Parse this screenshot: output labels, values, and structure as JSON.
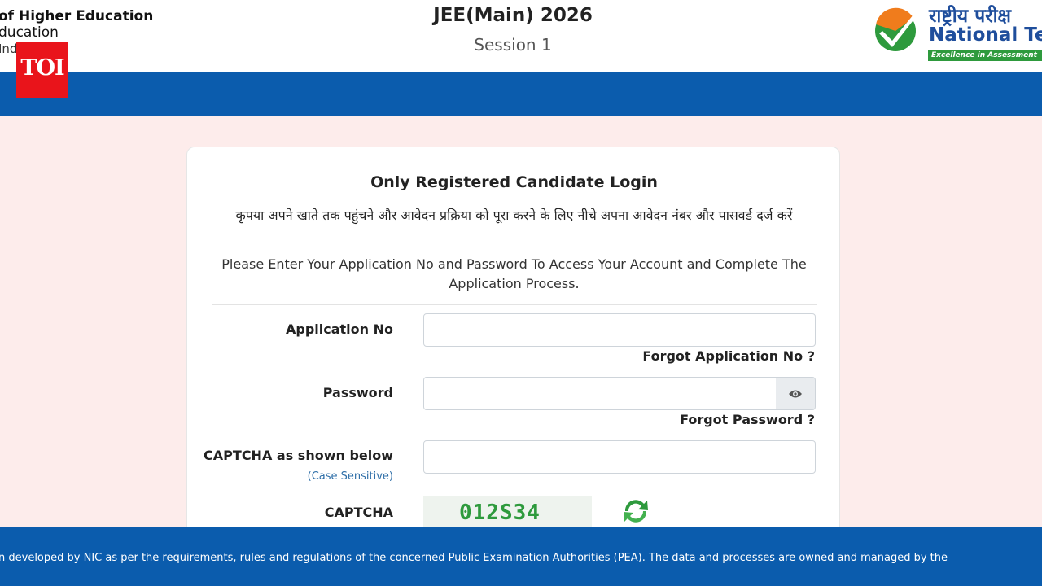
{
  "header": {
    "ministry_line1": "of Higher Education",
    "ministry_line2": "ducation",
    "ministry_line3": "Ind",
    "toi_badge": "TOI",
    "exam_title": "JEE(Main) 2026",
    "session": "Session 1",
    "nta_hindi": "राष्ट्रीय परीक्ष",
    "nta_english": "National Tes",
    "nta_tagline": "Excellence in Assessment"
  },
  "login": {
    "title": "Only Registered Candidate Login",
    "hindi_instruction": "कृपया अपने खाते तक पहुंचने और आवेदन प्रक्रिया को पूरा करने के लिए नीचे अपना आवेदन नंबर और पासवर्ड दर्ज करें",
    "english_instruction": "Please Enter Your Application No and Password To Access Your Account and Complete The Application Process.",
    "application_no_label": "Application No",
    "application_no_value": "",
    "forgot_application": "Forgot Application No ?",
    "password_label": "Password",
    "password_value": "",
    "forgot_password": "Forgot Password ?",
    "captcha_input_label": "CAPTCHA as shown below",
    "case_sensitive": "(Case Sensitive)",
    "captcha_input_value": "",
    "captcha_label": "CAPTCHA",
    "captcha_text": "012S34"
  },
  "footer": {
    "text": "n developed by NIC as per the requirements, rules and regulations of the concerned Public Examination Authorities (PEA). The data and processes are owned and managed by the"
  },
  "colors": {
    "primary_blue": "#0b5cad",
    "page_background": "#fdeceb",
    "toi_red": "#e9141b",
    "nta_blue": "#1f4e9c",
    "nta_green": "#2e9a3d",
    "nta_orange": "#f07c1c",
    "link_blue": "#2f6fa8"
  },
  "icons": {
    "password_toggle": "eye-icon",
    "captcha_refresh": "refresh-icon",
    "nta_logo": "checkmark-logo"
  }
}
